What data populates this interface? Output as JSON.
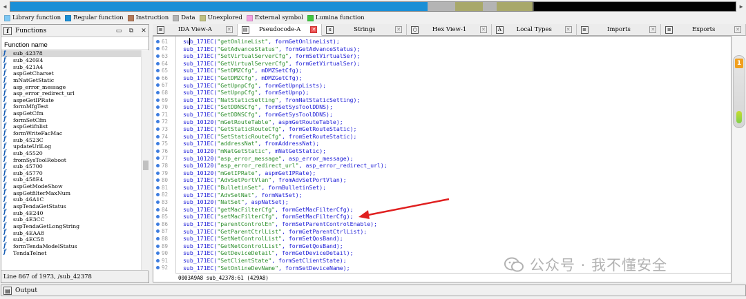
{
  "navigation": {
    "left_arrow": "◀",
    "right_arrow": "▶",
    "segments": [
      {
        "color": "#1a8fd6",
        "flex": 605
      },
      {
        "color": "#b4b4b4",
        "flex": 40
      },
      {
        "color": "#a8a86a",
        "flex": 40
      },
      {
        "color": "#b4b4b4",
        "flex": 20
      },
      {
        "color": "#a8a86a",
        "flex": 52
      },
      {
        "color": "#4a4a4a",
        "flex": 2
      },
      {
        "color": "#000000",
        "flex": 293
      }
    ]
  },
  "legend": [
    {
      "label": "Library function",
      "color": "#7ec8f5"
    },
    {
      "label": "Regular function",
      "color": "#1a8fd6"
    },
    {
      "label": "Instruction",
      "color": "#b47a5a"
    },
    {
      "label": "Data",
      "color": "#b4b4b4"
    },
    {
      "label": "Unexplored",
      "color": "#bfbf80"
    },
    {
      "label": "External symbol",
      "color": "#f2a0e0"
    },
    {
      "label": "Lumina function",
      "color": "#40c840"
    }
  ],
  "functions_panel": {
    "title": "Functions",
    "column_header": "Function name",
    "status": "Line 867 of 1973, /sub_42378",
    "items": [
      "sub_42378",
      "sub_420E4",
      "sub_421A4",
      "aspGetCharset",
      "mNatGetStatic",
      "asp_error_message",
      "asp_error_redirect_url",
      "aspeGetIPRate",
      "formMfgTest",
      "aspGetCfm",
      "formSetCfm",
      "aspGetifnlist",
      "formWriteFacMac",
      "sub_4523C",
      "updateUrlLog",
      "sub_45520",
      "fromSysToolReboot",
      "sub_45700",
      "sub_45770",
      "sub_458E4",
      "aspGetModeShow",
      "aspGetfilterMaxNum",
      "sub_46A1C",
      "aspTendaGetStatus",
      "sub_4E240",
      "sub_4E3CC",
      "aspTendaGetLongString",
      "sub_4EAA8",
      "sub_4EC58",
      "formTendaModelStatus",
      "TendaTelnet"
    ]
  },
  "tabs": [
    {
      "label": "IDA View-A",
      "icon": "text-view-icon",
      "glyph": "≡"
    },
    {
      "label": "Pseudocode-A",
      "icon": "pseudocode-icon",
      "glyph": "▤",
      "active": true
    },
    {
      "label": "Strings",
      "icon": "strings-icon",
      "glyph": "s"
    },
    {
      "label": "Hex View-1",
      "icon": "hex-view-icon",
      "glyph": "○"
    },
    {
      "label": "Local Types",
      "icon": "local-types-icon",
      "glyph": "A"
    },
    {
      "label": "Imports",
      "icon": "imports-icon",
      "glyph": "≡"
    },
    {
      "label": "Exports",
      "icon": "exports-icon",
      "glyph": "≡"
    }
  ],
  "code": {
    "lines": [
      {
        "num": "61",
        "fn": "sub_171EC",
        "str": "\"getOnlineList\"",
        "rest": ", formGetOnlineList);"
      },
      {
        "num": "62",
        "fn": "sub_171EC",
        "str": "\"GetAdvanceStatus\"",
        "rest": ", formGetAdvanceStatus);"
      },
      {
        "num": "63",
        "fn": "sub_171EC",
        "str": "\"SetVirtualServerCfg\"",
        "rest": ", formSetVirtualSer);"
      },
      {
        "num": "64",
        "fn": "sub_171EC",
        "str": "\"GetVirtualServerCfg\"",
        "rest": ", formGetVirtualSer);"
      },
      {
        "num": "65",
        "fn": "sub_171EC",
        "str": "\"SetDMZCfg\"",
        "rest": ", mDMZSetCfg);"
      },
      {
        "num": "66",
        "fn": "sub_171EC",
        "str": "\"GetDMZCfg\"",
        "rest": ", mDMZGetCfg);"
      },
      {
        "num": "67",
        "fn": "sub_171EC",
        "str": "\"GetUpnpCfg\"",
        "rest": ", formGetUpnpLists);"
      },
      {
        "num": "68",
        "fn": "sub_171EC",
        "str": "\"SetUpnpCfg\"",
        "rest": ", formSetUpnp);"
      },
      {
        "num": "69",
        "fn": "sub_171EC",
        "str": "\"NatStaticSetting\"",
        "rest": ", fromNatStaticSetting);"
      },
      {
        "num": "70",
        "fn": "sub_171EC",
        "str": "\"SetDDNSCfg\"",
        "rest": ", formSetSysToolDDNS);"
      },
      {
        "num": "71",
        "fn": "sub_171EC",
        "str": "\"GetDDNSCfg\"",
        "rest": ", formGetSysToolDDNS);"
      },
      {
        "num": "72",
        "fn": "sub_10120",
        "str": "\"mGetRouteTable\"",
        "rest": ", aspmGetRouteTable);"
      },
      {
        "num": "73",
        "fn": "sub_171EC",
        "str": "\"GetStaticRouteCfg\"",
        "rest": ", formGetRouteStatic);"
      },
      {
        "num": "74",
        "fn": "sub_171EC",
        "str": "\"SetStaticRouteCfg\"",
        "rest": ", fromSetRouteStatic);"
      },
      {
        "num": "75",
        "fn": "sub_171EC",
        "str": "\"addressNat\"",
        "rest": ", fromAddressNat);"
      },
      {
        "num": "76",
        "fn": "sub_10120",
        "str": "\"mNatGetStatic\"",
        "rest": ", mNatGetStatic);"
      },
      {
        "num": "77",
        "fn": "sub_10120",
        "str": "\"asp_error_message\"",
        "rest": ", asp_error_message);"
      },
      {
        "num": "78",
        "fn": "sub_10120",
        "str": "\"asp_error_redirect_url\"",
        "rest": ", asp_error_redirect_url);"
      },
      {
        "num": "79",
        "fn": "sub_10120",
        "str": "\"mGetIPRate\"",
        "rest": ", aspmGetIPRate);"
      },
      {
        "num": "80",
        "fn": "sub_171EC",
        "str": "\"AdvSetPortVlan\"",
        "rest": ", fromAdvSetPortVlan);"
      },
      {
        "num": "81",
        "fn": "sub_171EC",
        "str": "\"BulletinSet\"",
        "rest": ", formBulletinSet);"
      },
      {
        "num": "82",
        "fn": "sub_171EC",
        "str": "\"AdvSetNat\"",
        "rest": ", formNatSet);"
      },
      {
        "num": "83",
        "fn": "sub_10120",
        "str": "\"NatSet\"",
        "rest": ", aspNatSet);"
      },
      {
        "num": "84",
        "fn": "sub_171EC",
        "str": "\"getMacFilterCfg\"",
        "rest": ", formGetMacFilterCfg);"
      },
      {
        "num": "85",
        "fn": "sub_171EC",
        "str": "\"setMacFilterCfg\"",
        "rest": ", formSetMacFilterCfg);"
      },
      {
        "num": "86",
        "fn": "sub_171EC",
        "str": "\"parentControlEn\"",
        "rest": ", formSetParentControlEnable);"
      },
      {
        "num": "87",
        "fn": "sub_171EC",
        "str": "\"GetParentCtrlList\"",
        "rest": ", formGetParentCtrlList);"
      },
      {
        "num": "88",
        "fn": "sub_171EC",
        "str": "\"SetNetControlList\"",
        "rest": ", formSetQosBand);"
      },
      {
        "num": "89",
        "fn": "sub_171EC",
        "str": "\"GetNetControlList\"",
        "rest": ", formGetQosBand);"
      },
      {
        "num": "90",
        "fn": "sub_171EC",
        "str": "\"GetDeviceDetail\"",
        "rest": ", formGetDeviceDetail);"
      },
      {
        "num": "91",
        "fn": "sub_171EC",
        "str": "\"SetClientState\"",
        "rest": ", formSetClientState);"
      },
      {
        "num": "92",
        "fn": "sub_171EC",
        "str": "\"SetOnlineDevName\"",
        "rest": ", formSetDeviceName);"
      }
    ],
    "status": "0003A9A8 sub_42378:61 (429A8)"
  },
  "overview_badge": "1",
  "output_title": "Output",
  "watermark": "公众号 · 我不懂安全",
  "annotation_color": "#e02020"
}
